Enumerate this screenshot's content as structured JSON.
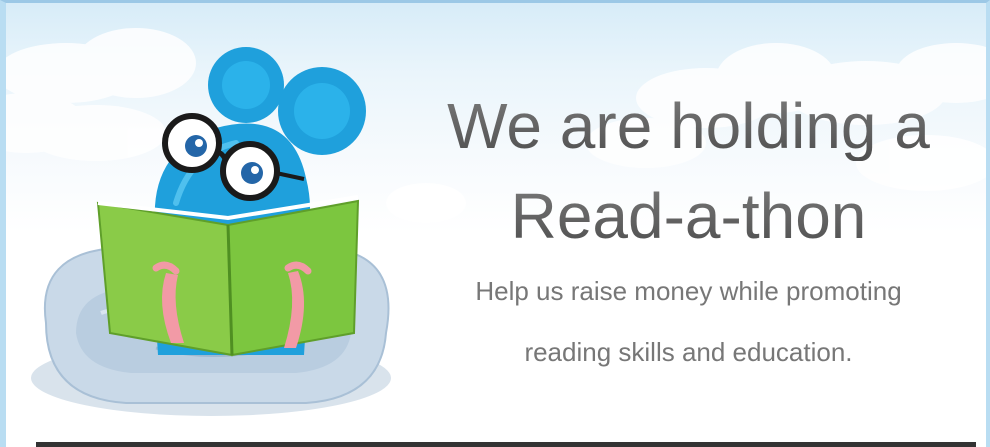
{
  "banner": {
    "headline_line1": "We are holding a",
    "headline_line2": "Read-a-thon",
    "subtext_line1": "Help us raise money while promoting",
    "subtext_line2": "reading skills and education."
  },
  "colors": {
    "sky": "#d7ecf8",
    "mouse_blue": "#1fa0dc",
    "book_green": "#7cc63f",
    "cushion": "#c8daea",
    "headline_text": "#5f5f5f",
    "subtext": "#777777"
  },
  "icons": {
    "mascot": "reading-mouse-illustration",
    "clouds": "cloud-background"
  }
}
